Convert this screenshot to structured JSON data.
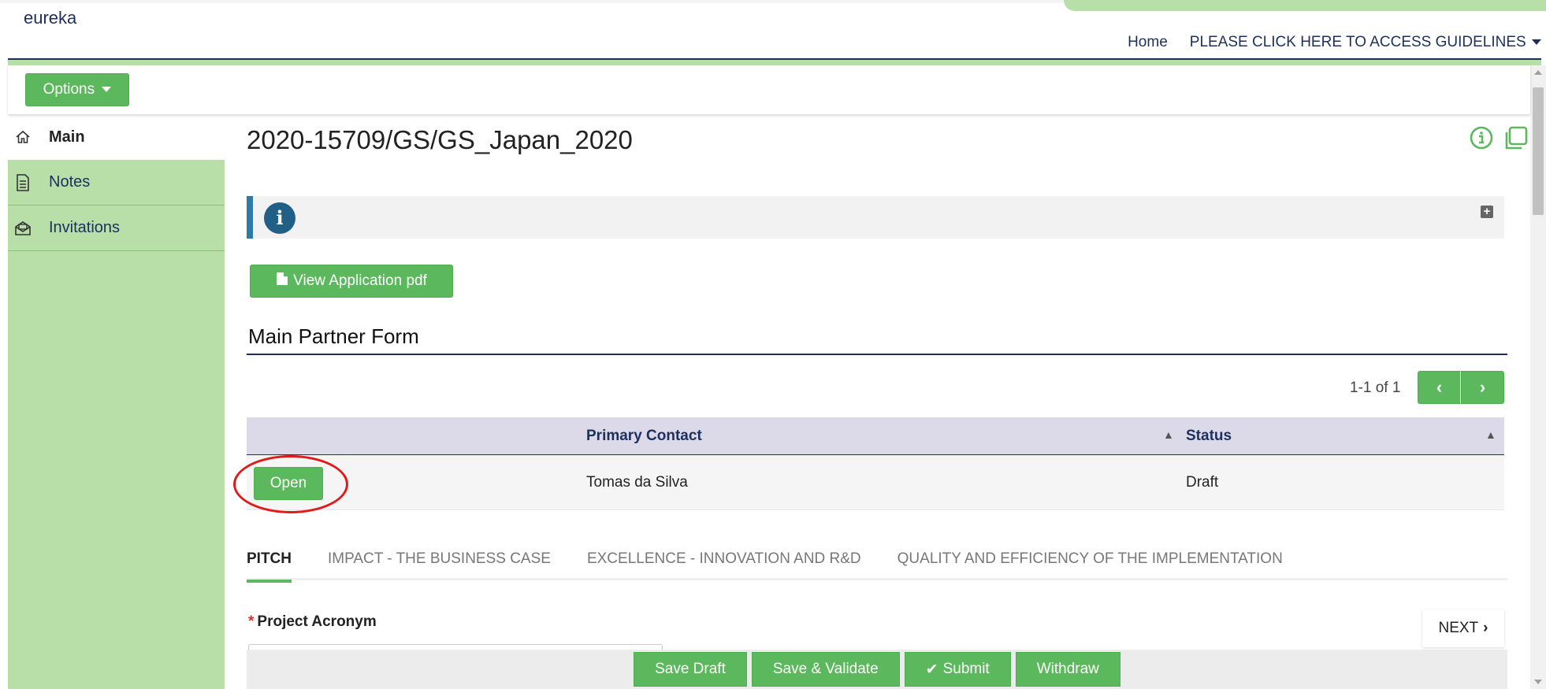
{
  "header": {
    "brand": "eureka",
    "nav": {
      "home": "Home",
      "guidelines": "PLEASE CLICK HERE TO ACCESS GUIDELINES"
    }
  },
  "toolbar": {
    "options_label": "Options"
  },
  "sidebar": {
    "items": [
      {
        "label": "Main",
        "icon": "home-icon",
        "active": true
      },
      {
        "label": "Notes",
        "icon": "document-icon",
        "active": false
      },
      {
        "label": "Invitations",
        "icon": "envelope-icon",
        "active": false
      }
    ]
  },
  "main": {
    "title": "2020-15709/GS/GS_Japan_2020",
    "info_icon": "info-icon",
    "view_pdf_label": "View Application pdf",
    "section_title": "Main Partner Form",
    "pager_text": "1-1 of 1",
    "grid": {
      "columns": [
        "Primary Contact",
        "Status"
      ],
      "rows": [
        {
          "action": "Open",
          "primary_contact": "Tomas da Silva",
          "status": "Draft"
        }
      ]
    },
    "tabs": [
      {
        "label": "PITCH",
        "active": true
      },
      {
        "label": "IMPACT - THE BUSINESS CASE",
        "active": false
      },
      {
        "label": "EXCELLENCE - INNOVATION AND R&D",
        "active": false
      },
      {
        "label": "QUALITY AND EFFICIENCY OF THE IMPLEMENTATION",
        "active": false
      }
    ],
    "form": {
      "required_mark": "*",
      "project_acronym_label": "Project Acronym",
      "project_acronym_value": ""
    },
    "next_label": "NEXT"
  },
  "footer": {
    "save_draft": "Save Draft",
    "save_validate": "Save & Validate",
    "submit": "Submit",
    "withdraw": "Withdraw"
  },
  "colors": {
    "accent_green": "#5cb85c",
    "sidebar_green": "#b9dfa9",
    "navy": "#1d2f5e",
    "info_blue": "#215f86",
    "highlight_red": "#e01b1b"
  }
}
